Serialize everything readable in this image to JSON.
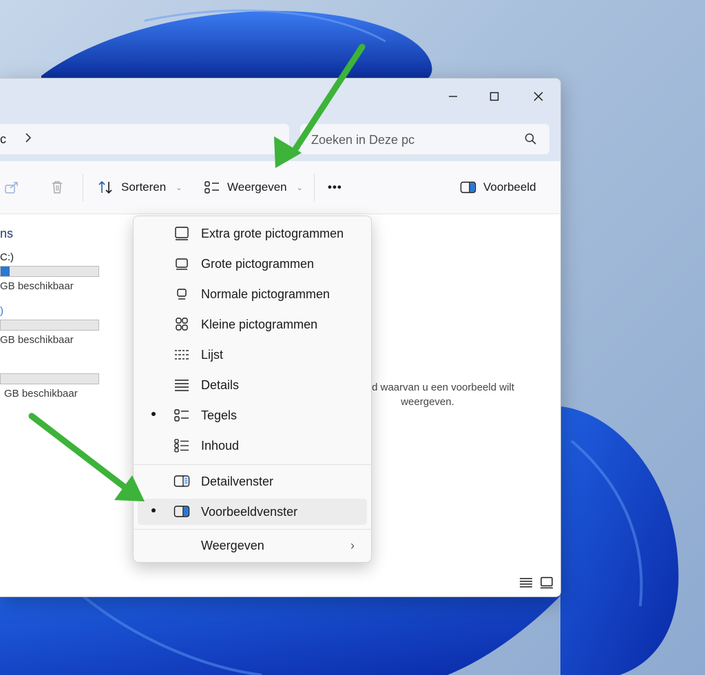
{
  "window": {
    "address_path": "c",
    "search_placeholder": "Zoeken in Deze pc"
  },
  "toolbar": {
    "sort_label": "Sorteren",
    "view_label": "Weergeven",
    "more_label": "•••",
    "preview_label": "Voorbeeld"
  },
  "leftpane": {
    "header": "ns",
    "drive1_name": "C:)",
    "drive1_free": "GB beschikbaar",
    "drive1_used": 0.09,
    "drive2_name": ")",
    "drive2_free": "GB beschikbaar",
    "drive3_free": "GB beschikbaar"
  },
  "preview_pane": {
    "message_line1": "bestand waarvan u een voorbeeld wilt",
    "message_line2": "weergeven."
  },
  "view_menu": {
    "items": [
      {
        "label": "Extra grote pictogrammen",
        "selected": false
      },
      {
        "label": "Grote pictogrammen",
        "selected": false
      },
      {
        "label": "Normale pictogrammen",
        "selected": false
      },
      {
        "label": "Kleine pictogrammen",
        "selected": false
      },
      {
        "label": "Lijst",
        "selected": false
      },
      {
        "label": "Details",
        "selected": false
      },
      {
        "label": "Tegels",
        "selected": true
      },
      {
        "label": "Inhoud",
        "selected": false
      }
    ],
    "panes": [
      {
        "label": "Detailvenster",
        "selected": false
      },
      {
        "label": "Voorbeeldvenster",
        "selected": true
      }
    ],
    "submenu_label": "Weergeven",
    "submenu_chevron": "›"
  },
  "colors": {
    "annotation_arrow": "#3db33a",
    "accent": "#2a78d4"
  }
}
